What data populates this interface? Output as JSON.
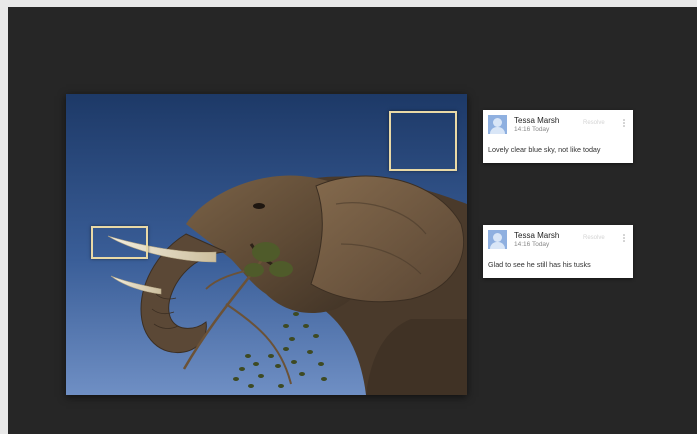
{
  "photo": {
    "alt": "Elephant eating branch against blue sky"
  },
  "comments": [
    {
      "author": "Tessa Marsh",
      "time": "14:16 Today",
      "resolve_label": "Resolve",
      "text": "Lovely clear blue sky, not like today",
      "avatar_icon": "user-avatar-icon"
    },
    {
      "author": "Tessa Marsh",
      "time": "14:16 Today",
      "resolve_label": "Resolve",
      "text": "Glad to see he still has his tusks",
      "avatar_icon": "user-avatar-icon"
    }
  ],
  "colors": {
    "background": "#262626",
    "region_outline": "#e9d9a6",
    "avatar": "#8fb0e0"
  }
}
